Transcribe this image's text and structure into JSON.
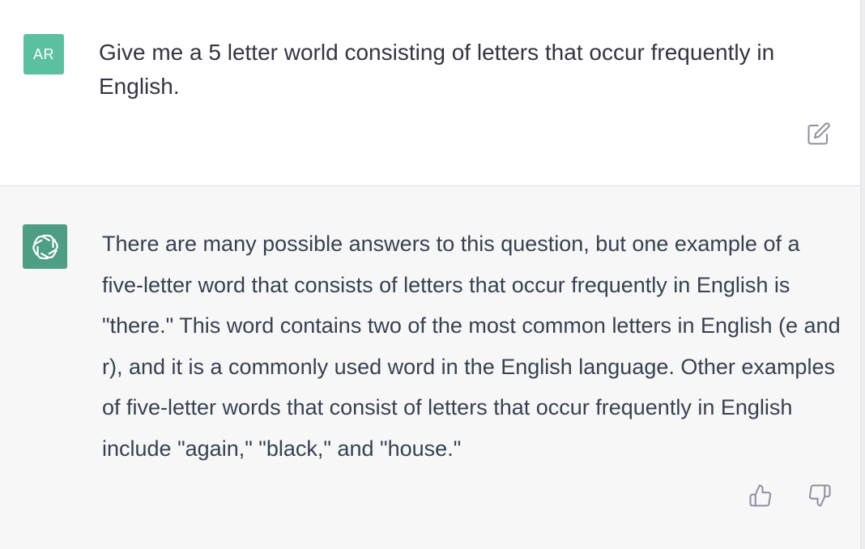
{
  "conversation": {
    "user_message": {
      "avatar_initials": "AR",
      "text": "Give me a 5 letter world consisting of letters that occur frequently in English."
    },
    "assistant_message": {
      "text": "There are many possible answers to this question, but one example of a five-letter word that consists of letters that occur frequently in English is \"there.\" This word contains two of the most common letters in English (e and r), and it is a commonly used word in the English language. Other examples of five-letter words that consist of letters that occur frequently in English include \"again,\" \"black,\" and \"house.\""
    }
  },
  "icons": {
    "assistant_avatar": "openai-logo-icon",
    "edit": "edit-icon",
    "thumbs_up": "thumbs-up-icon",
    "thumbs_down": "thumbs-down-icon"
  },
  "colors": {
    "user_avatar_bg": "#5bc09f",
    "assistant_avatar_bg": "#4e9e86",
    "assistant_row_bg": "#f7f7f8",
    "text": "#343541",
    "icon_gray": "#8e8ea0"
  }
}
